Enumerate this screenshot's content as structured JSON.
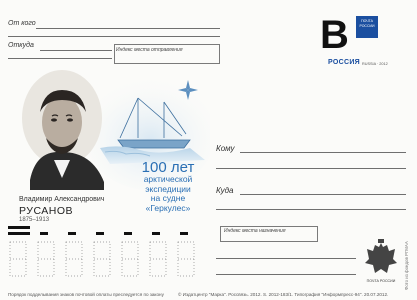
{
  "sender": {
    "from_label": "От кого",
    "from_label_tiny": "",
    "address_label": "Откуда",
    "index_label": "Индекс места отправления"
  },
  "stamp": {
    "letter": "B",
    "logo_text": "ПОЧТА РОССИИ",
    "country": "РОССИЯ",
    "sub": "RUSSIA · 2012"
  },
  "portrait": {
    "first_name": "Владимир Александрович",
    "surname": "РУСАНОВ",
    "years": "1875–1913"
  },
  "title": {
    "line1": "100 лет",
    "line2": "арктической",
    "line3": "экспедиции",
    "line4": "на судне",
    "line5": "«Геркулес»"
  },
  "recipient": {
    "to_label": "Кому",
    "where_label": "Куда",
    "dest_index_label": "Индекс места назначения"
  },
  "footer": {
    "notice": "Порядок подделывания знаков почтовой оплаты преследуется по закону",
    "imprint": "© Издатцентр \"Марка\". Россвязь. 2012. S. 2012-183/1. Типография \"Информпресс-94\". 20.07.2012.",
    "emblem_label": "ПОЧТА РОССИИ"
  },
  "side_text": "Фото из фондов РГМАА",
  "colors": {
    "accent_blue": "#2a6fb4",
    "stamp_blue": "#1b4fa0",
    "ink": "#111111"
  }
}
